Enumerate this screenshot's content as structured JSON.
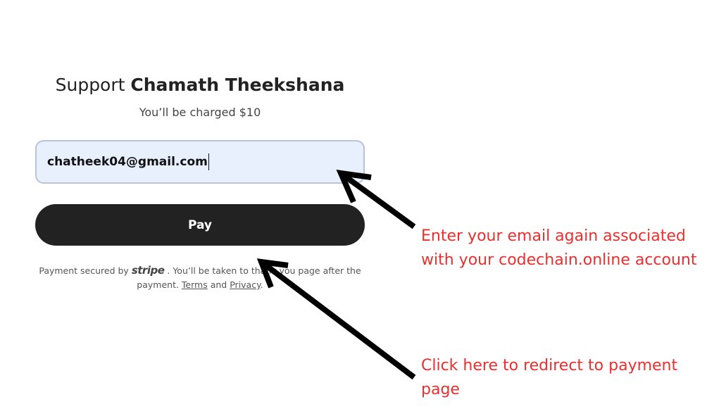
{
  "header": {
    "title_prefix": "Support",
    "title_name": "Chamath Theekshana",
    "charge_text": "You’ll be charged $10"
  },
  "form": {
    "email_value": "chatheek04@gmail.com",
    "pay_label": "Pay"
  },
  "footer": {
    "text_before": "Payment secured by",
    "stripe_logo": "stripe",
    "text_middle": ". You’ll be taken to thank you page after the payment.",
    "terms_label": "Terms",
    "and_text": "and",
    "privacy_label": "Privacy",
    "end_text": "."
  },
  "annotations": {
    "note_email": "Enter your email again associated with your codechain.online account",
    "note_pay": "Click here to redirect to payment page",
    "note_color": "#ea2f2f",
    "arrow_color": "#000000"
  }
}
